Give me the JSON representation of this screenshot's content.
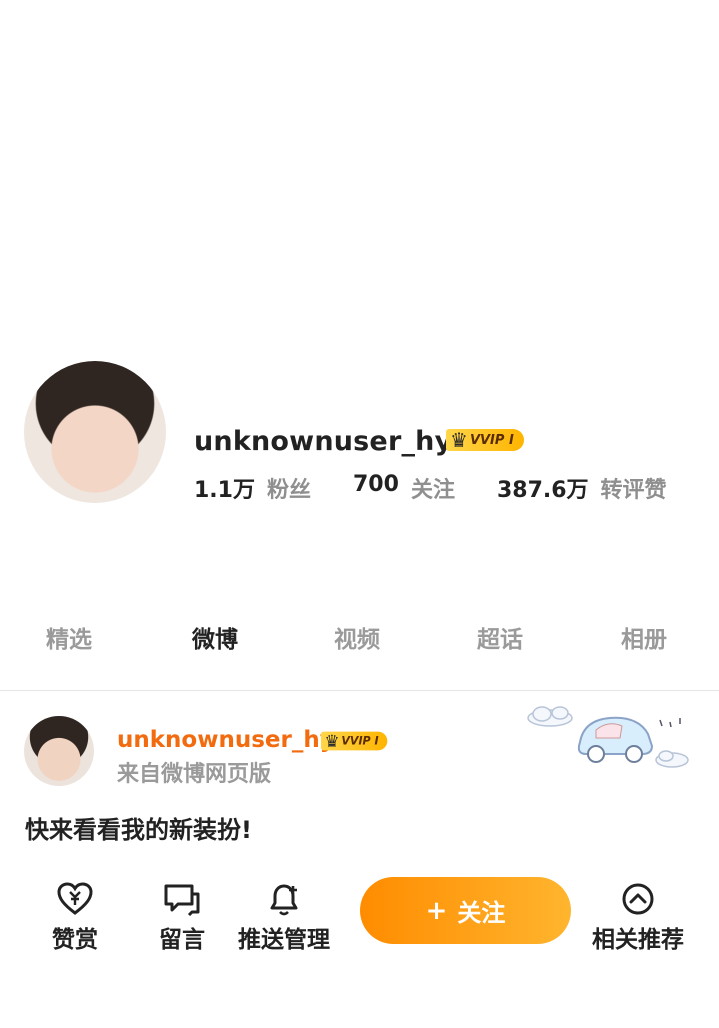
{
  "profile": {
    "username": "unknownuser_hy",
    "badge": "VVIP I",
    "stats": [
      {
        "value": "1.1万",
        "label": "粉丝"
      },
      {
        "value": "700",
        "label": "关注"
      },
      {
        "value": "387.6万",
        "label": "转评赞"
      }
    ]
  },
  "tabs": [
    {
      "label": "精选"
    },
    {
      "label": "微博",
      "active": true
    },
    {
      "label": "视频"
    },
    {
      "label": "超话"
    },
    {
      "label": "相册"
    }
  ],
  "post": {
    "username": "unknownuser_hy",
    "badge": "VVIP I",
    "source": "来自微博网页版",
    "text": "快来看看我的新装扮!"
  },
  "bottom_bar": {
    "reward": "赞赏",
    "message": "留言",
    "push": "推送管理",
    "follow": "关注",
    "follow_plus": "+",
    "recommend": "相关推荐"
  },
  "colors": {
    "accent_orange": "#f26b0f",
    "follow_gradient_start": "#ff8c00",
    "follow_gradient_end": "#ffb52e",
    "vip_gold": "#ffc21a"
  },
  "icons": [
    "crown-icon",
    "heart-yen-icon",
    "comment-icon",
    "bell-plus-icon",
    "chevron-up-circle-icon"
  ]
}
